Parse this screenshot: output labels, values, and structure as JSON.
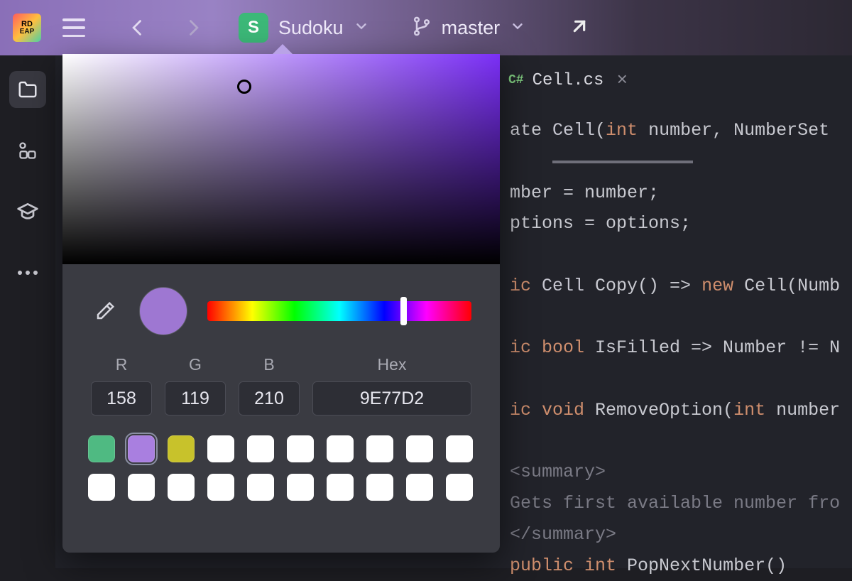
{
  "app": {
    "icon_line1": "RD",
    "icon_line2": "EAP"
  },
  "nav": {
    "project_initial": "S",
    "project_name": "Sudoku",
    "branch": "master"
  },
  "rail": {
    "items": [
      "folder",
      "structure",
      "learn",
      "more"
    ]
  },
  "tab": {
    "lang": "C#",
    "filename": "Cell.cs"
  },
  "code": {
    "l1a": "ate ",
    "l1b": "Cell",
    "l1c": "(",
    "l1d": "int ",
    "l1e": "number, NumberSet ",
    "l2a": "mber = number;",
    "l3a": "ptions = options;",
    "l4a": "ic ",
    "l4b": "Cell ",
    "l4c": "Copy() => ",
    "l4d": "new ",
    "l4e": "Cell(Numb",
    "l5a": "ic ",
    "l5b": "bool ",
    "l5c": "IsFilled => Number != N",
    "l6a": "ic ",
    "l6b": "void ",
    "l6c": "RemoveOption(",
    "l6d": "int ",
    "l6e": "number",
    "l7": "<summary>",
    "l8": "Gets first available number fro",
    "l9": "</summary>",
    "l10a": "public ",
    "l10b": "int ",
    "l10c": "PopNextNumber()"
  },
  "picker": {
    "labels": {
      "r": "R",
      "g": "G",
      "b": "B",
      "hex": "Hex"
    },
    "r": "158",
    "g": "119",
    "b": "210",
    "hex": "9E77D2",
    "current": "#9e77d2",
    "presets": [
      "#4fba82",
      "#a97fe0",
      "#c8c22b",
      "#ffffff",
      "#ffffff",
      "#ffffff",
      "#ffffff",
      "#ffffff",
      "#ffffff",
      "#ffffff",
      "#ffffff",
      "#ffffff",
      "#ffffff",
      "#ffffff",
      "#ffffff",
      "#ffffff",
      "#ffffff",
      "#ffffff",
      "#ffffff",
      "#ffffff"
    ]
  }
}
